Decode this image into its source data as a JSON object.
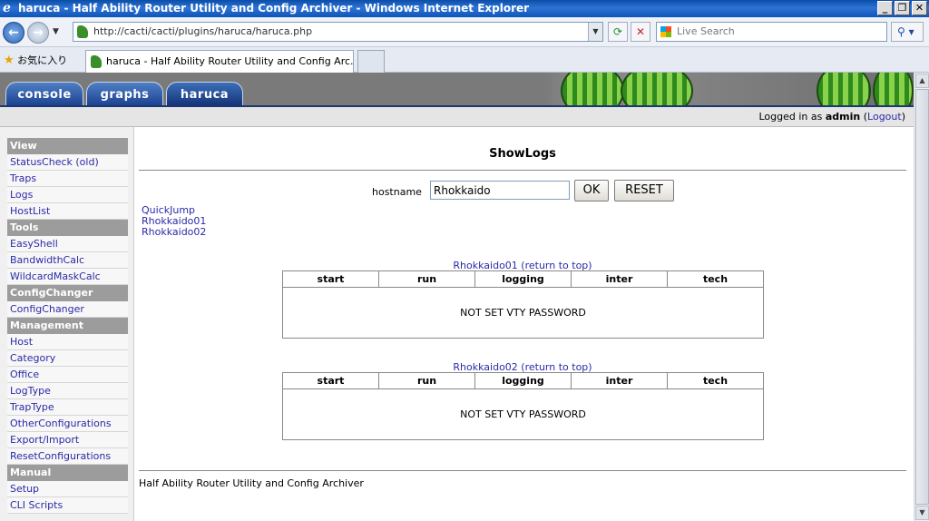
{
  "window": {
    "title": "haruca - Half Ability Router Utility and Config Archiver - Windows Internet Explorer",
    "minimize": "_",
    "maximize": "❐",
    "close": "✕"
  },
  "browser": {
    "url": "http://cacti/cacti/plugins/haruca/haruca.php",
    "search_placeholder": "Live Search",
    "favorites_label": "お気に入り",
    "tab_title": "haruca - Half Ability Router Utility and Config Arc..."
  },
  "nav_tabs": [
    "console",
    "graphs",
    "haruca"
  ],
  "login": {
    "prefix": "Logged in as",
    "user": "admin",
    "open_paren": "(",
    "logout": "Logout",
    "close_paren": ")"
  },
  "sidebar": {
    "sections": [
      {
        "heading": "View",
        "items": [
          "StatusCheck  (old)",
          "Traps",
          "Logs",
          "HostList"
        ]
      },
      {
        "heading": "Tools",
        "items": [
          "EasyShell",
          "BandwidthCalc",
          "WildcardMaskCalc"
        ]
      },
      {
        "heading": "ConfigChanger",
        "items": [
          "ConfigChanger"
        ]
      },
      {
        "heading": "Management",
        "items": [
          "Host",
          "Category",
          "Office",
          "LogType",
          "TrapType",
          "OtherConfigurations",
          "Export/Import",
          "ResetConfigurations"
        ]
      },
      {
        "heading": "Manual",
        "items": [
          "Setup",
          "CLI Scripts"
        ]
      }
    ]
  },
  "main": {
    "heading": "ShowLogs",
    "hostname_label": "hostname",
    "hostname_value": "Rhokkaido",
    "ok_label": "OK",
    "reset_label": "RESET",
    "quickjump": [
      "QuickJump",
      "Rhokkaido01",
      "Rhokkaido02"
    ],
    "columns": [
      "start",
      "run",
      "logging",
      "inter",
      "tech"
    ],
    "sections": [
      {
        "title": "Rhokkaido01 (return to top)",
        "message": "NOT SET VTY PASSWORD"
      },
      {
        "title": "Rhokkaido02 (return to top)",
        "message": "NOT SET VTY PASSWORD"
      }
    ],
    "footer": "Half Ability Router Utility and Config Archiver"
  }
}
